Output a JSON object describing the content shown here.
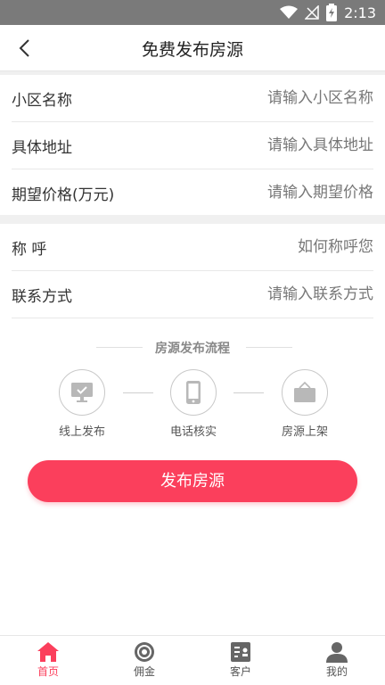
{
  "status_bar": {
    "time": "2:13"
  },
  "header": {
    "title": "免费发布房源"
  },
  "form": {
    "group1": [
      {
        "label": "小区名称",
        "placeholder": "请输入小区名称"
      },
      {
        "label": "具体地址",
        "placeholder": "请输入具体地址"
      },
      {
        "label": "期望价格(万元)",
        "placeholder": "请输入期望价格"
      }
    ],
    "group2": [
      {
        "label": "称 呼",
        "placeholder": "如何称呼您"
      },
      {
        "label": "联系方式",
        "placeholder": "请输入联系方式"
      }
    ]
  },
  "process": {
    "title": "房源发布流程",
    "steps": [
      {
        "label": "线上发布",
        "icon": "monitor-check-icon"
      },
      {
        "label": "电话核实",
        "icon": "phone-icon"
      },
      {
        "label": "房源上架",
        "icon": "sale-tag-icon"
      }
    ]
  },
  "publish_button": {
    "label": "发布房源"
  },
  "tabbar": {
    "tabs": [
      {
        "label": "首页",
        "icon": "home-icon",
        "active": true
      },
      {
        "label": "佣金",
        "icon": "coin-icon",
        "active": false
      },
      {
        "label": "客户",
        "icon": "card-icon",
        "active": false
      },
      {
        "label": "我的",
        "icon": "user-icon",
        "active": false
      }
    ]
  },
  "colors": {
    "accent": "#fb3f5c",
    "status_bar": "#7a7a7a",
    "icon_gray": "#666666"
  }
}
